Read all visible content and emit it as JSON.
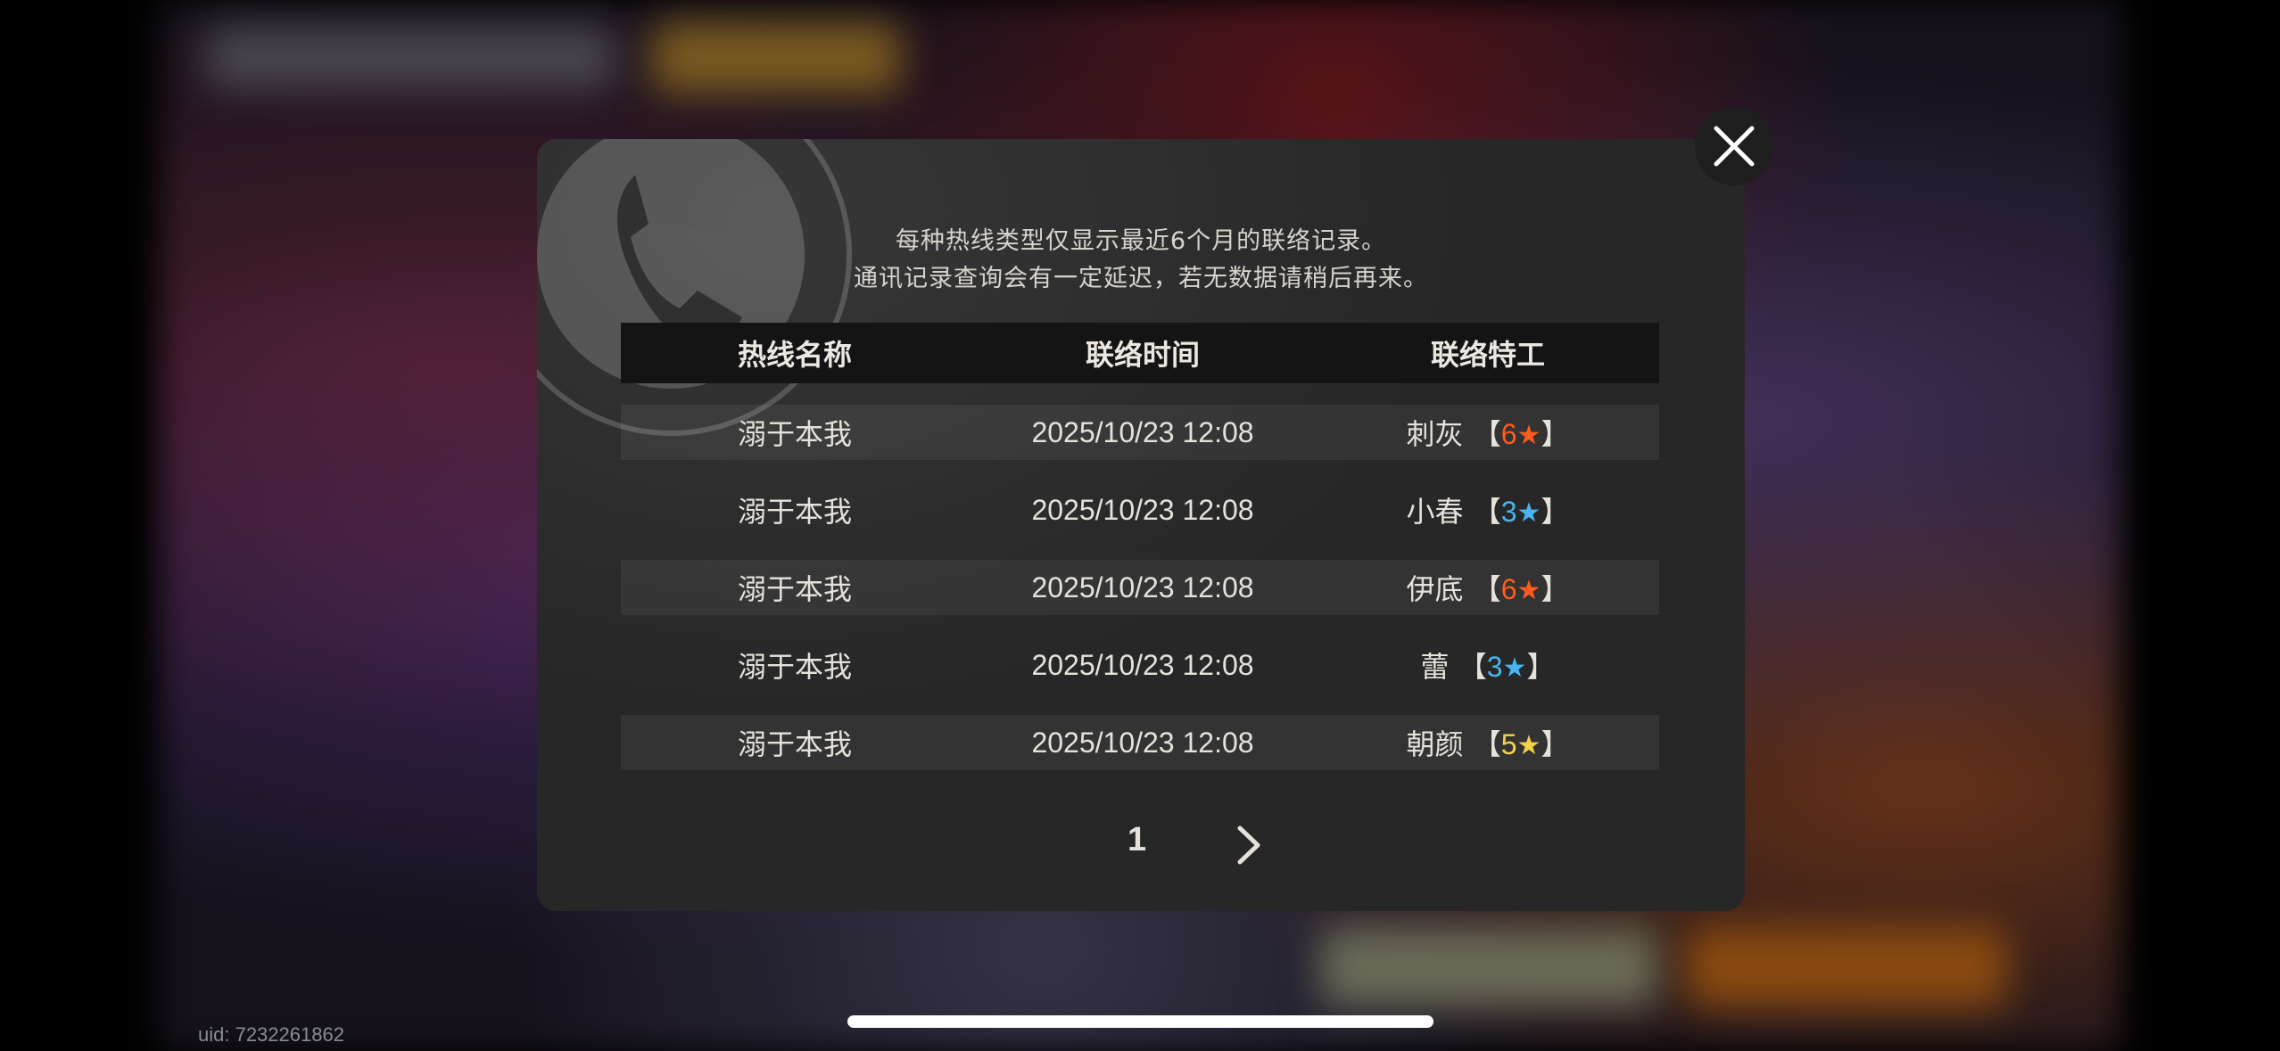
{
  "uid": "uid: 7232261862",
  "dialog": {
    "notice_line1": "每种热线类型仅显示最近6个月的联络记录。",
    "notice_line2": "通讯记录查询会有一定延迟，若无数据请稍后再来。",
    "columns": [
      "热线名称",
      "联络时间",
      "联络特工"
    ],
    "rows": [
      {
        "hotline": "溺于本我",
        "time": "2025/10/23 12:08",
        "agent": "刺灰",
        "rank": "6",
        "rank_color": "#ff5a1f"
      },
      {
        "hotline": "溺于本我",
        "time": "2025/10/23 12:08",
        "agent": "小春",
        "rank": "3",
        "rank_color": "#49b4f0"
      },
      {
        "hotline": "溺于本我",
        "time": "2025/10/23 12:08",
        "agent": "伊底",
        "rank": "6",
        "rank_color": "#ff5a1f"
      },
      {
        "hotline": "溺于本我",
        "time": "2025/10/23 12:08",
        "agent": "蕾",
        "rank": "3",
        "rank_color": "#49b4f0"
      },
      {
        "hotline": "溺于本我",
        "time": "2025/10/23 12:08",
        "agent": "朝颜",
        "rank": "5",
        "rank_color": "#f3d24a"
      }
    ],
    "bracket_open": "【",
    "bracket_close": "】",
    "star_glyph": "★",
    "page": "1"
  },
  "icons": {
    "close": "close-icon",
    "next": "chevron-right-icon",
    "decor": "phone-icon"
  }
}
